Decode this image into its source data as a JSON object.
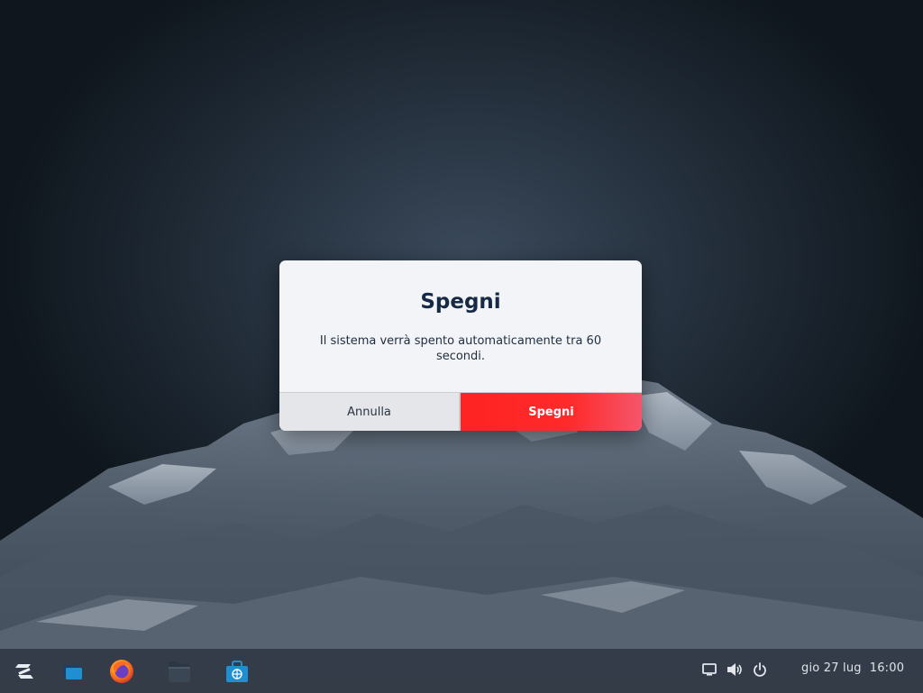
{
  "dialog": {
    "title": "Spegni",
    "message": "Il sistema verrà spento automaticamente tra 60 secondi.",
    "cancel_label": "Annulla",
    "confirm_label": "Spegni"
  },
  "taskbar": {
    "apps": [
      "zorin-menu-icon",
      "window-overview-icon",
      "firefox-icon",
      "files-icon",
      "software-store-icon"
    ],
    "tray": [
      "screen-icon",
      "volume-icon",
      "power-icon"
    ],
    "date": "gio 27 lug",
    "time": "16:00"
  },
  "colors": {
    "dialog_bg": "#f3f4f8",
    "title": "#162a45",
    "destructive": "#ff2323",
    "taskbar_accent": "#1f8fd1"
  }
}
